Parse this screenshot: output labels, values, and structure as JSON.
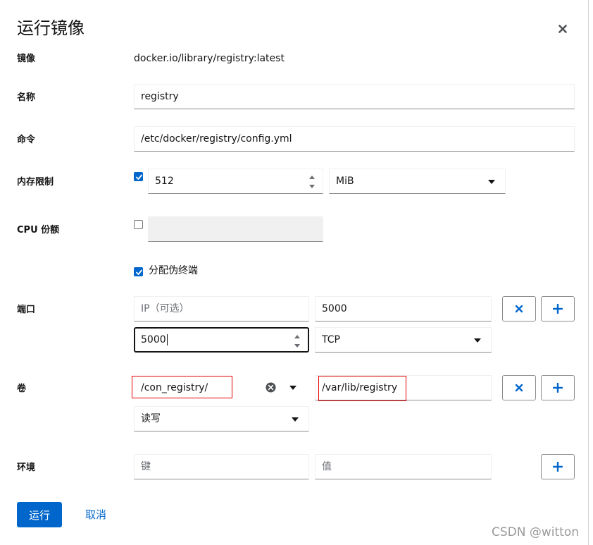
{
  "dialog": {
    "title": "运行镜像",
    "close_label": "×"
  },
  "labels": {
    "image": "镜像",
    "name": "名称",
    "command": "命令",
    "memory": "内存限制",
    "cpu": "CPU 份额",
    "ports": "端口",
    "volumes": "卷",
    "env": "环境"
  },
  "image": {
    "value": "docker.io/library/registry:latest"
  },
  "name": {
    "value": "registry"
  },
  "command": {
    "value": "/etc/docker/registry/config.yml"
  },
  "memory": {
    "enabled": true,
    "value": "512",
    "unit": "MiB"
  },
  "cpu": {
    "enabled": false,
    "value": ""
  },
  "tty": {
    "enabled": true,
    "label": "分配伪终端"
  },
  "ports": {
    "ip_placeholder": "IP（可选）",
    "host_port": "5000",
    "container_port": "5000",
    "protocol": "TCP"
  },
  "volumes": {
    "host_path": "/con_registry/",
    "container_path": "/var/lib/registry",
    "mode": "读写"
  },
  "env": {
    "key_placeholder": "键",
    "value_placeholder": "值"
  },
  "buttons": {
    "run": "运行",
    "cancel": "取消",
    "remove": "×",
    "add": "+"
  },
  "watermark": "CSDN @witton",
  "colors": {
    "primary": "#0066cc",
    "highlight_box": "#e00000",
    "text": "#151515",
    "placeholder": "#6a6e73"
  }
}
